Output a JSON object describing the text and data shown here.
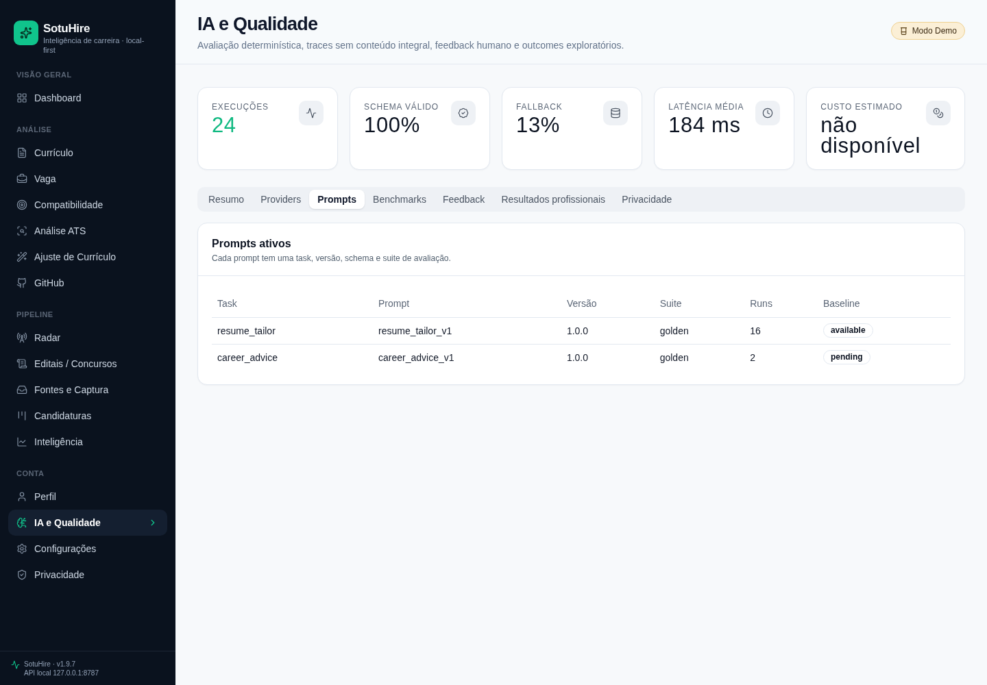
{
  "sidebar": {
    "brand": {
      "name": "SotuHire",
      "tagline": "Inteligência de carreira · local-first"
    },
    "sections": [
      {
        "title": "VISÃO GERAL",
        "items": [
          {
            "label": "Dashboard",
            "selected": false
          }
        ]
      },
      {
        "title": "ANÁLISE",
        "items": [
          {
            "label": "Currículo",
            "selected": false
          },
          {
            "label": "Vaga",
            "selected": false
          },
          {
            "label": "Compatibilidade",
            "selected": false
          },
          {
            "label": "Análise ATS",
            "selected": false
          },
          {
            "label": "Ajuste de Currículo",
            "selected": false
          },
          {
            "label": "GitHub",
            "selected": false
          }
        ]
      },
      {
        "title": "PIPELINE",
        "items": [
          {
            "label": "Radar",
            "selected": false
          },
          {
            "label": "Editais / Concursos",
            "selected": false
          },
          {
            "label": "Fontes e Captura",
            "selected": false
          },
          {
            "label": "Candidaturas",
            "selected": false
          },
          {
            "label": "Inteligência",
            "selected": false
          }
        ]
      },
      {
        "title": "CONTA",
        "items": [
          {
            "label": "Perfil",
            "selected": false
          },
          {
            "label": "IA e Qualidade",
            "selected": true
          },
          {
            "label": "Configurações",
            "selected": false
          },
          {
            "label": "Privacidade",
            "selected": false
          }
        ]
      }
    ],
    "footer": {
      "version": "SotuHire · v1.9.7",
      "api": "API local 127.0.0.1:8787"
    }
  },
  "header": {
    "title": "IA e Qualidade",
    "subtitle": "Avaliação determinística, traces sem conteúdo integral, feedback humano e outcomes exploratórios.",
    "badge": "Modo Demo"
  },
  "stats": [
    {
      "label": "EXECUÇÕES",
      "value": "24",
      "color": "#10b981"
    },
    {
      "label": "SCHEMA VÁLIDO",
      "value": "100%",
      "color": "#0b1220"
    },
    {
      "label": "FALLBACK",
      "value": "13%",
      "color": "#0b1220"
    },
    {
      "label": "LATÊNCIA MÉDIA",
      "value": "184 ms",
      "color": "#0b1220"
    },
    {
      "label": "CUSTO ESTIMADO",
      "value": "não disponível",
      "color": "#0b1220"
    }
  ],
  "tabs": [
    {
      "label": "Resumo",
      "selected": false
    },
    {
      "label": "Providers",
      "selected": false
    },
    {
      "label": "Prompts",
      "selected": true
    },
    {
      "label": "Benchmarks",
      "selected": false
    },
    {
      "label": "Feedback",
      "selected": false
    },
    {
      "label": "Resultados profissionais",
      "selected": false
    },
    {
      "label": "Privacidade",
      "selected": false
    }
  ],
  "panel": {
    "title": "Prompts ativos",
    "subtitle": "Cada prompt tem uma task, versão, schema e suite de avaliação.",
    "table": {
      "columns": [
        "Task",
        "Prompt",
        "Versão",
        "Suite",
        "Runs",
        "Baseline"
      ],
      "rows": [
        {
          "task": "resume_tailor",
          "prompt": "resume_tailor_v1",
          "version": "1.0.0",
          "suite": "golden",
          "runs": "16",
          "baseline": "available"
        },
        {
          "task": "career_advice",
          "prompt": "career_advice_v1",
          "version": "1.0.0",
          "suite": "golden",
          "runs": "2",
          "baseline": "pending"
        }
      ]
    }
  }
}
